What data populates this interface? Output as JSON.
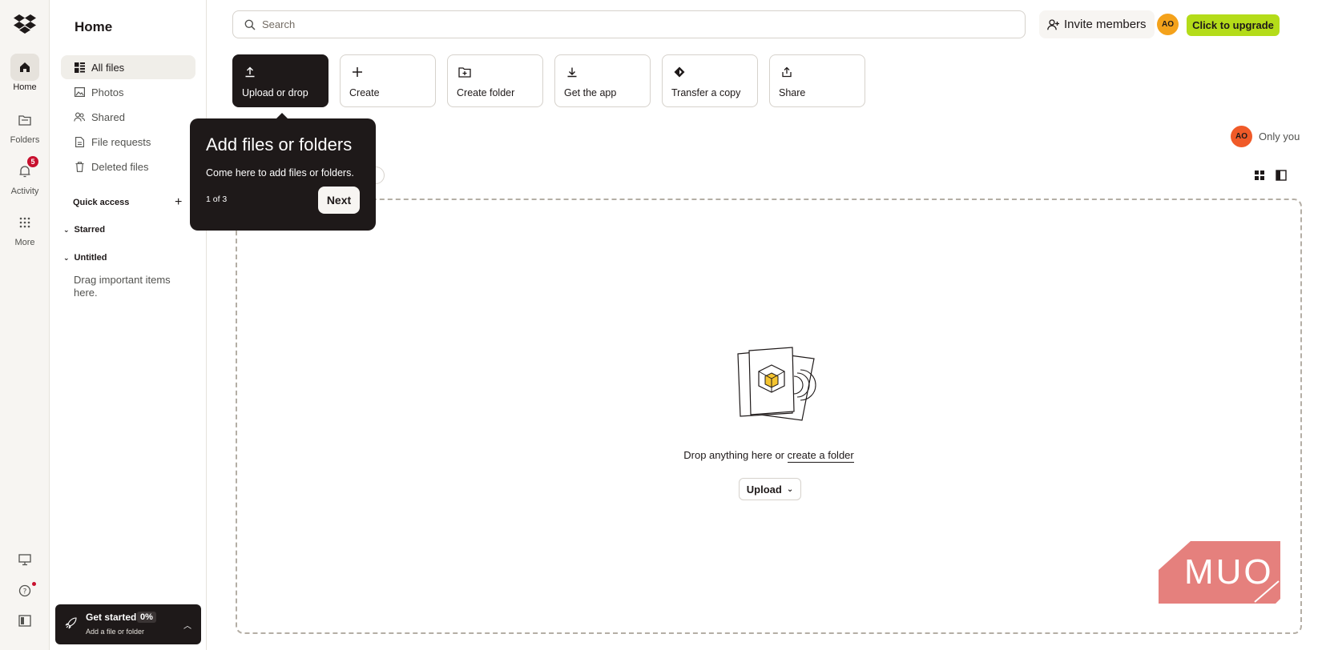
{
  "rail": {
    "items": [
      {
        "label": "Home"
      },
      {
        "label": "Folders"
      },
      {
        "label": "Activity",
        "badge": "5"
      },
      {
        "label": "More"
      }
    ]
  },
  "sidebar": {
    "title": "Home",
    "items": [
      {
        "label": "All files",
        "icon": "all-files-icon"
      },
      {
        "label": "Photos",
        "icon": "photos-icon"
      },
      {
        "label": "Shared",
        "icon": "shared-icon"
      },
      {
        "label": "File requests",
        "icon": "file-requests-icon"
      },
      {
        "label": "Deleted files",
        "icon": "trash-icon"
      }
    ],
    "quick_access": "Quick access",
    "starred": "Starred",
    "untitled": "Untitled",
    "hint": "Drag important items here.",
    "get_started": {
      "title": "Get started",
      "percent": "0%",
      "subtitle": "Add a file or folder"
    }
  },
  "topbar": {
    "search_placeholder": "Search",
    "invite_label": "Invite members",
    "avatar_initials": "AO",
    "upgrade_label": "Click to upgrade"
  },
  "actions": [
    {
      "label": "Upload or drop",
      "icon": "upload-icon"
    },
    {
      "label": "Create",
      "icon": "plus-icon"
    },
    {
      "label": "Create folder",
      "icon": "folder-plus-icon"
    },
    {
      "label": "Get the app",
      "icon": "download-icon"
    },
    {
      "label": "Transfer a copy",
      "icon": "transfer-icon"
    },
    {
      "label": "Share",
      "icon": "share-icon"
    }
  ],
  "tooltip": {
    "title": "Add files or folders",
    "description": "Come here to add files or folders.",
    "counter": "1 of 3",
    "next_label": "Next"
  },
  "sharing": {
    "initials": "AO",
    "label": "Only you"
  },
  "dropzone": {
    "text": "Drop anything here or ",
    "link": "create a folder",
    "upload_label": "Upload"
  },
  "watermark": {
    "text": "MUO"
  },
  "colors": {
    "accent": "#b4dc19",
    "dark": "#1e1919",
    "avatar": "#f4a21b",
    "badge": "#c8102e"
  }
}
